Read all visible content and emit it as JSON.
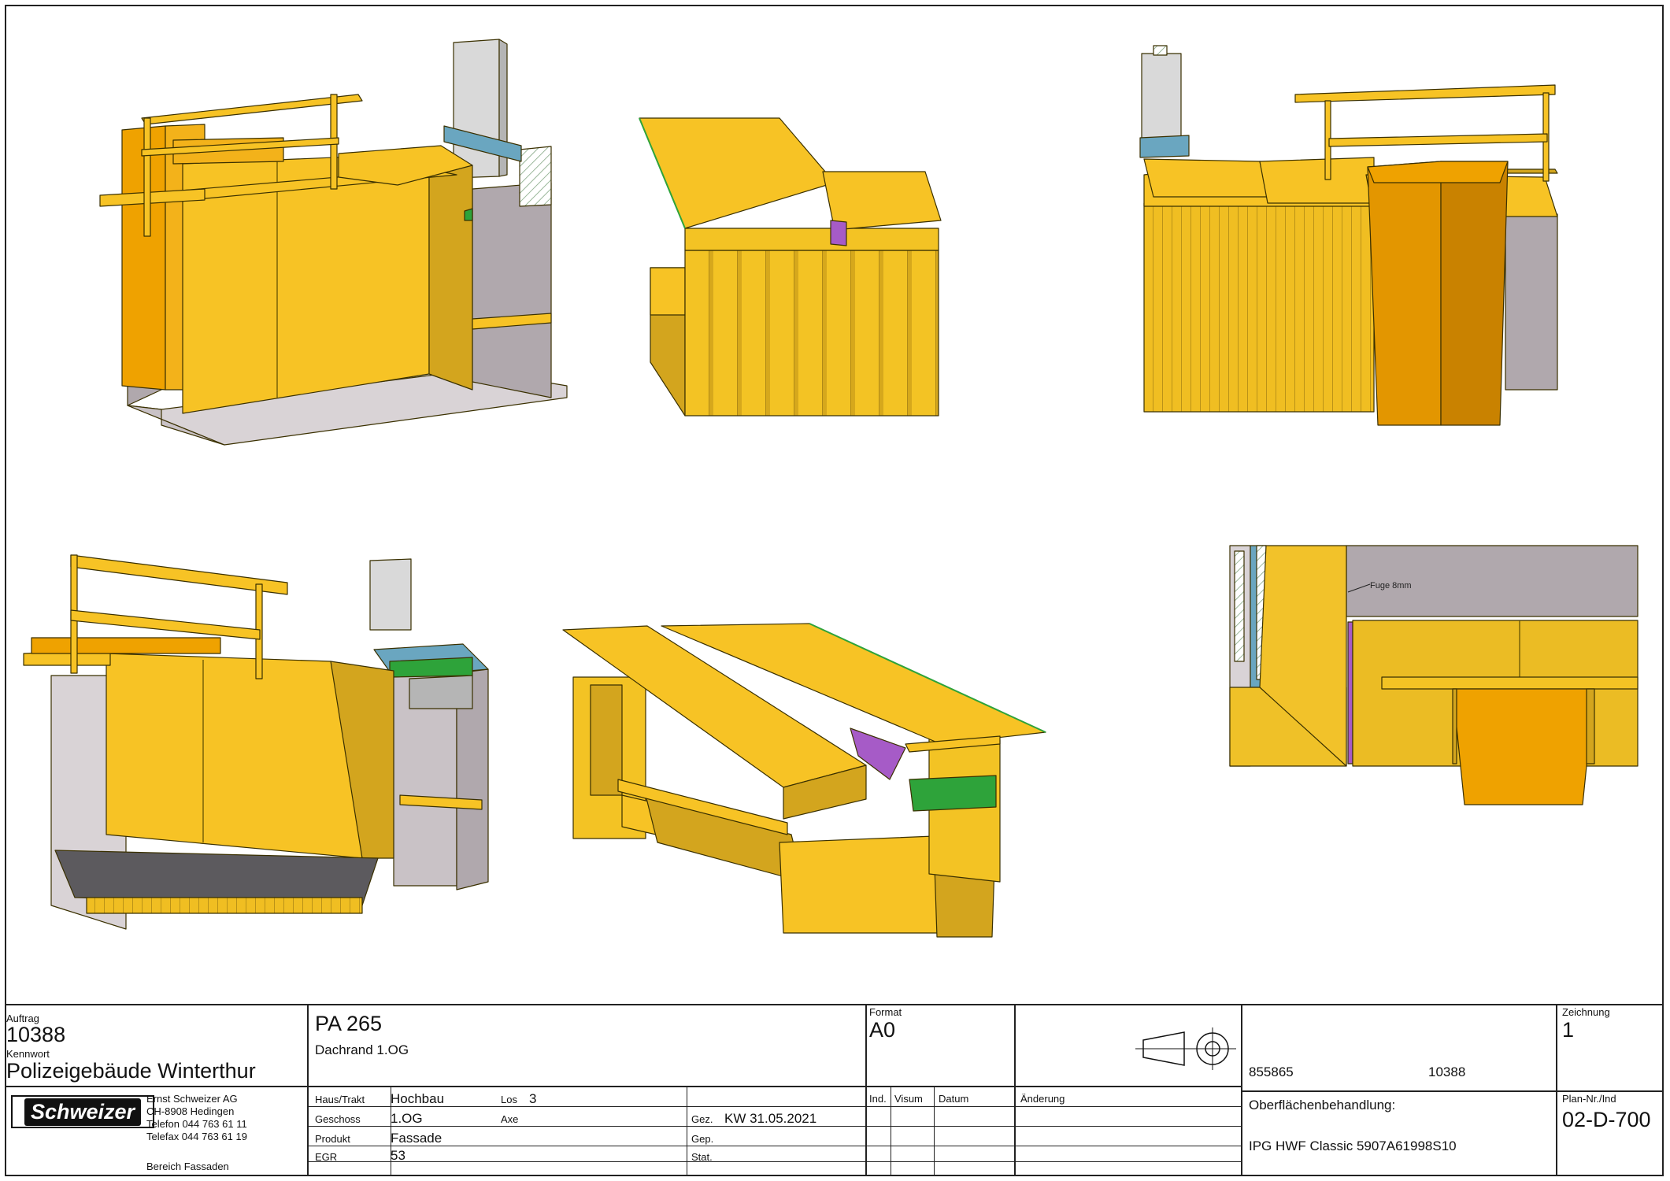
{
  "drawing": {
    "views": [
      {
        "name": "iso-view-front-left",
        "detail_label": ""
      },
      {
        "name": "iso-view-section-side",
        "detail_label": ""
      },
      {
        "name": "iso-view-rear-right",
        "detail_label": ""
      },
      {
        "name": "iso-view-underside",
        "detail_label": ""
      },
      {
        "name": "iso-view-cut-perspective",
        "detail_label": ""
      },
      {
        "name": "detail-section-view",
        "detail_label": "Fuge 8mm"
      }
    ],
    "colors": {
      "yellow": "#F7C325",
      "dark_yellow": "#D3A51E",
      "orange": "#EFA200",
      "grey": "#B0A8AD",
      "light_grey": "#D9D3D6",
      "blue": "#6AA6C0",
      "purple": "#A65BC7",
      "green": "#2EA33A"
    }
  },
  "title_block": {
    "auftrag_label": "Auftrag",
    "auftrag_value": "10388",
    "kennwort_label": "Kennwort",
    "kennwort_value": "Polizeigebäude Winterthur",
    "company": {
      "logo_text": "Schweizer",
      "name": "Ernst Schweizer AG",
      "address": "CH-8908 Hedingen",
      "phone": "Telefon 044 763 61 11",
      "fax": "Telefax 044 763 61 19",
      "department": "Bereich Fassaden"
    },
    "project_code": "PA 265",
    "project_desc": "Dachrand 1.OG",
    "format_label": "Format",
    "format_value": "A0",
    "ref_left": "855865",
    "ref_right": "10388",
    "zeichnung_label": "Zeichnung",
    "zeichnung_value": "1",
    "plan_label": "Plan-Nr./Ind",
    "plan_value": "02-D-700",
    "rows": [
      {
        "label": "Haus/Trakt",
        "value": "Hochbau",
        "label2": "Los",
        "value2": "3"
      },
      {
        "label": "Geschoss",
        "value": "1.OG",
        "label2": "Axe",
        "value2": ""
      },
      {
        "label": "Produkt",
        "value": "Fassade",
        "label2": "",
        "value2": ""
      },
      {
        "label": "EGR",
        "value": "53",
        "label2": "",
        "value2": ""
      }
    ],
    "gez_label": "Gez.",
    "gez_value": "KW  31.05.2021",
    "gep_label": "Gep.",
    "stat_label": "Stat.",
    "revision_headers": {
      "ind": "Ind.",
      "visum": "Visum",
      "datum": "Datum",
      "aenderung": "Änderung"
    },
    "surface_label": "Oberflächenbehandlung:",
    "surface_value": "IPG HWF Classic 5907A61998S10"
  }
}
